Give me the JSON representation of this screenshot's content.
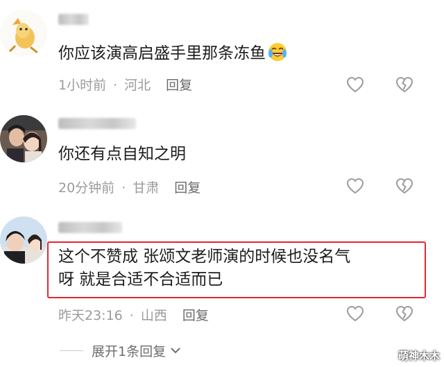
{
  "comments": [
    {
      "text": "你应该演高启盛手里那条冻鱼",
      "emoji": "laughing-crying-emoji",
      "time": "1小时前",
      "separator": "·",
      "location": "河北",
      "reply_label": "回复"
    },
    {
      "text": "你还有点自知之明",
      "time": "20分钟前",
      "separator": "·",
      "location": "甘肃",
      "reply_label": "回复"
    },
    {
      "text_line1": "这个不赞成 张颂文老师演的时候也没名气",
      "text_line2": "呀 就是合适不合适而已",
      "time": "昨天23:16",
      "separator": "·",
      "location": "山西",
      "reply_label": "回复"
    }
  ],
  "expand_replies_label": "展开1条回复",
  "watermark": "萌神木木",
  "colors": {
    "highlight": "#e0282e",
    "meta": "#9b9b9b"
  }
}
